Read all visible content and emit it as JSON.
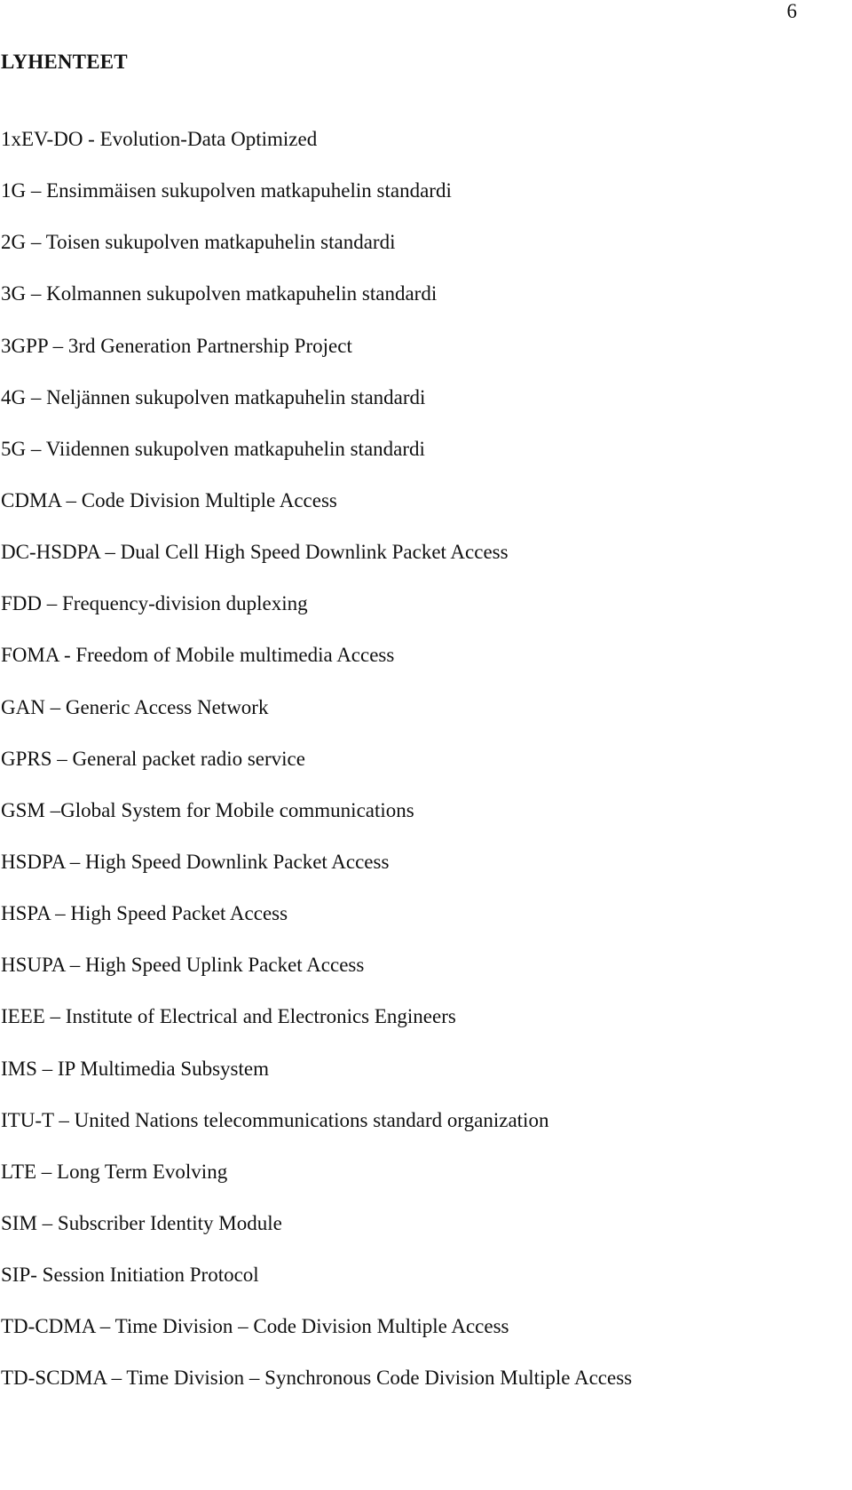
{
  "page": {
    "page_number": "6",
    "heading": "LYHENTEET"
  },
  "abbreviations": [
    {
      "text": "1xEV-DO - Evolution-Data Optimized"
    },
    {
      "text": "1G – Ensimmäisen sukupolven matkapuhelin standardi"
    },
    {
      "text": "2G – Toisen sukupolven matkapuhelin standardi"
    },
    {
      "text": "3G – Kolmannen sukupolven matkapuhelin standardi"
    },
    {
      "text": "3GPP – 3rd Generation Partnership Project"
    },
    {
      "text": "4G – Neljännen sukupolven matkapuhelin standardi"
    },
    {
      "text": "5G – Viidennen sukupolven matkapuhelin standardi"
    },
    {
      "text": "CDMA – Code Division Multiple Access"
    },
    {
      "text": "DC-HSDPA – Dual Cell High Speed Downlink Packet Access"
    },
    {
      "text": "FDD – Frequency-division duplexing"
    },
    {
      "text": "FOMA - Freedom of Mobile multimedia Access"
    },
    {
      "text": "GAN – Generic Access Network"
    },
    {
      "text": "GPRS – General packet radio service"
    },
    {
      "text": "GSM –Global System for Mobile communications"
    },
    {
      "text": "HSDPA – High Speed Downlink Packet Access"
    },
    {
      "text": "HSPA – High Speed Packet Access"
    },
    {
      "text": "HSUPA – High Speed Uplink Packet Access"
    },
    {
      "text": "IEEE – Institute of Electrical and Electronics Engineers"
    },
    {
      "text": "IMS – IP Multimedia Subsystem"
    },
    {
      "text": "ITU-T – United Nations telecommunications standard organization"
    },
    {
      "text": "LTE – Long Term Evolving"
    },
    {
      "text": "SIM – Subscriber Identity Module"
    },
    {
      "text": "SIP- Session Initiation Protocol"
    },
    {
      "text": "TD-CDMA – Time Division – Code Division Multiple Access"
    },
    {
      "text": "TD-SCDMA – Time Division – Synchronous Code Division Multiple Access"
    }
  ]
}
